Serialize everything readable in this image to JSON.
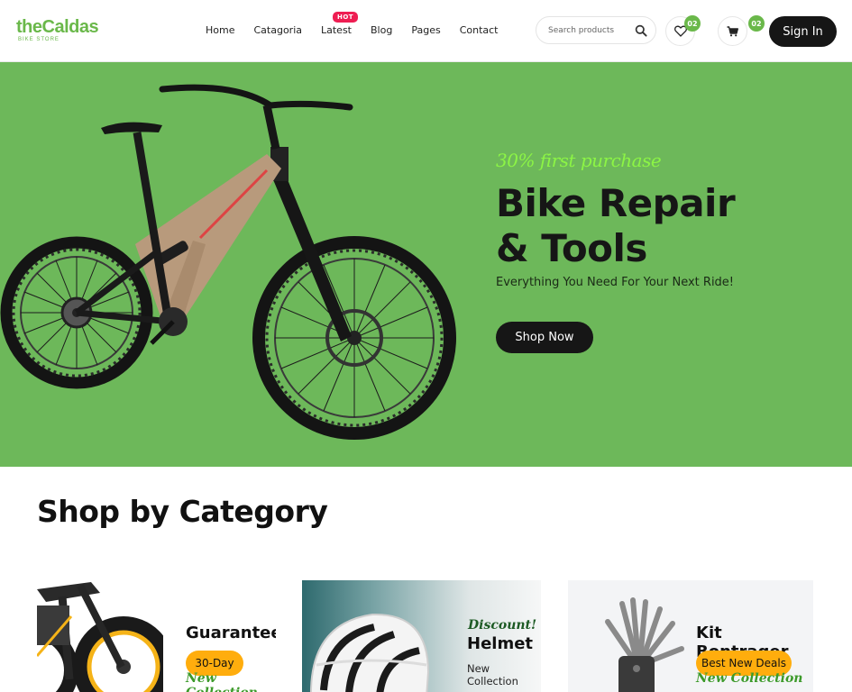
{
  "brand": {
    "name": "theCaldas",
    "tagline": "BIKE STORE",
    "accent_color": "#6ab84a"
  },
  "nav": {
    "items": [
      "Home",
      "Catagoria",
      "Latest",
      "Blog",
      "Pages",
      "Contact"
    ],
    "hot_badge": "HOT"
  },
  "search": {
    "placeholder": "Search products",
    "icon": "search-icon"
  },
  "wishlist": {
    "icon": "heart-icon",
    "count": "02"
  },
  "cart": {
    "icon": "cart-icon",
    "count": "02"
  },
  "signin_label": "Sign In",
  "hero": {
    "promo": "30% first purchase",
    "title_line1": "Bike Repair",
    "title_line2": "& Tools",
    "subtitle": "Everything You Need For Your Next Ride!",
    "cta": "Shop Now",
    "background_color": "#6db85a"
  },
  "category": {
    "title": "Shop by Category",
    "cards": [
      {
        "name": "Guarantee",
        "pill": "30-Day",
        "script": "New Collection"
      },
      {
        "name": "Helmet",
        "script": "Discount!",
        "note": "New Collection"
      },
      {
        "name": "Kit Bontrager",
        "pill": "Best New Deals",
        "script": "New Collection"
      }
    ],
    "pill_color": "#ffad0d"
  }
}
